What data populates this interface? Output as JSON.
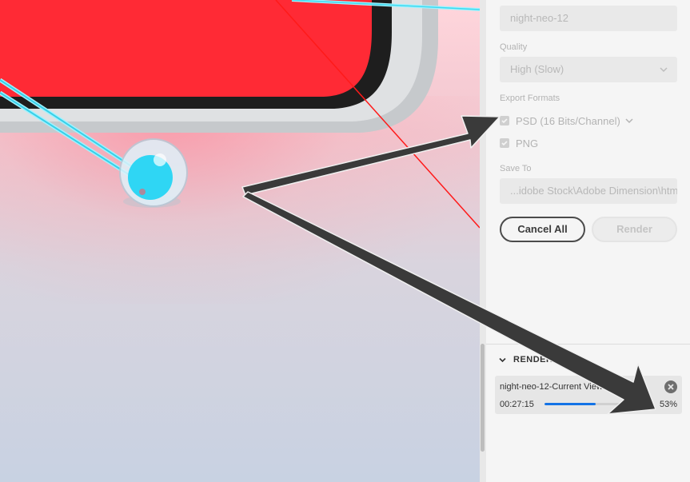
{
  "panel": {
    "filename_value": "night-neo-12",
    "quality": {
      "label": "Quality",
      "value": "High (Slow)"
    },
    "export_formats": {
      "label": "Export Formats",
      "options": [
        {
          "label": "PSD (16 Bits/Channel)",
          "checked": true,
          "has_dropdown": true
        },
        {
          "label": "PNG",
          "checked": true,
          "has_dropdown": false
        }
      ]
    },
    "save_to": {
      "label": "Save To",
      "value": "...idobe Stock\\Adobe Dimension\\html"
    },
    "buttons": {
      "cancel_all": "Cancel All",
      "render": "Render"
    }
  },
  "render_section": {
    "header": "RENDER",
    "job": {
      "name": "night-neo-12-Current View",
      "elapsed": "00:27:15",
      "progress_text": "53%",
      "progress": 0.53
    }
  },
  "colors": {
    "accent_blue": "#1473e6",
    "object_red": "#ff2a35",
    "arrow": "#3a3a3a"
  }
}
